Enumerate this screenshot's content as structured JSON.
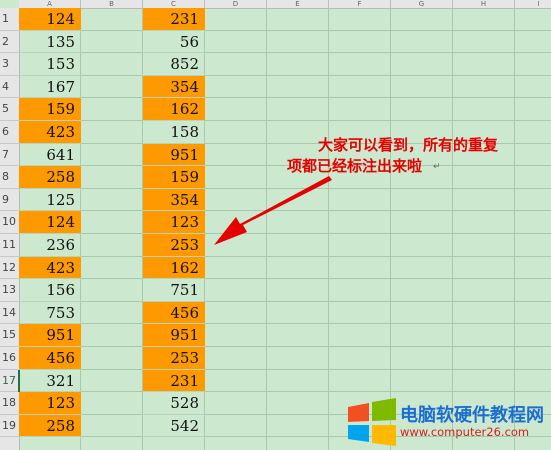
{
  "columns": [
    "A",
    "B",
    "C",
    "D",
    "E",
    "F",
    "G",
    "H",
    "I"
  ],
  "rows": [
    {
      "num": "1",
      "a": "124",
      "a_hl": true,
      "c": "231",
      "c_hl": true
    },
    {
      "num": "2",
      "a": "135",
      "a_hl": false,
      "c": "56",
      "c_hl": false
    },
    {
      "num": "3",
      "a": "153",
      "a_hl": false,
      "c": "852",
      "c_hl": false
    },
    {
      "num": "4",
      "a": "167",
      "a_hl": false,
      "c": "354",
      "c_hl": true
    },
    {
      "num": "5",
      "a": "159",
      "a_hl": true,
      "c": "162",
      "c_hl": true
    },
    {
      "num": "6",
      "a": "423",
      "a_hl": true,
      "c": "158",
      "c_hl": false
    },
    {
      "num": "7",
      "a": "641",
      "a_hl": false,
      "c": "951",
      "c_hl": true
    },
    {
      "num": "8",
      "a": "258",
      "a_hl": true,
      "c": "159",
      "c_hl": true
    },
    {
      "num": "9",
      "a": "125",
      "a_hl": false,
      "c": "354",
      "c_hl": true
    },
    {
      "num": "10",
      "a": "124",
      "a_hl": true,
      "c": "123",
      "c_hl": true
    },
    {
      "num": "11",
      "a": "236",
      "a_hl": false,
      "c": "253",
      "c_hl": true
    },
    {
      "num": "12",
      "a": "423",
      "a_hl": true,
      "c": "162",
      "c_hl": true
    },
    {
      "num": "13",
      "a": "156",
      "a_hl": false,
      "c": "751",
      "c_hl": false
    },
    {
      "num": "14",
      "a": "753",
      "a_hl": false,
      "c": "456",
      "c_hl": true
    },
    {
      "num": "15",
      "a": "951",
      "a_hl": true,
      "c": "951",
      "c_hl": true
    },
    {
      "num": "16",
      "a": "456",
      "a_hl": true,
      "c": "253",
      "c_hl": true
    },
    {
      "num": "17",
      "a": "321",
      "a_hl": false,
      "c": "231",
      "c_hl": true
    },
    {
      "num": "18",
      "a": "123",
      "a_hl": true,
      "c": "528",
      "c_hl": false
    },
    {
      "num": "19",
      "a": "258",
      "a_hl": true,
      "c": "542",
      "c_hl": false
    }
  ],
  "active_row": "17",
  "annotation": {
    "line1": "大家可以看到，所有的重复",
    "line2": "项都已经标注出来啦"
  },
  "watermark": {
    "title": "电脑软硬件教程网",
    "url": "www.computer26.com"
  },
  "colors": {
    "highlight": "#ff9900",
    "background": "#cce8cf",
    "annotation": "#e60000",
    "arrow": "#e60000"
  }
}
